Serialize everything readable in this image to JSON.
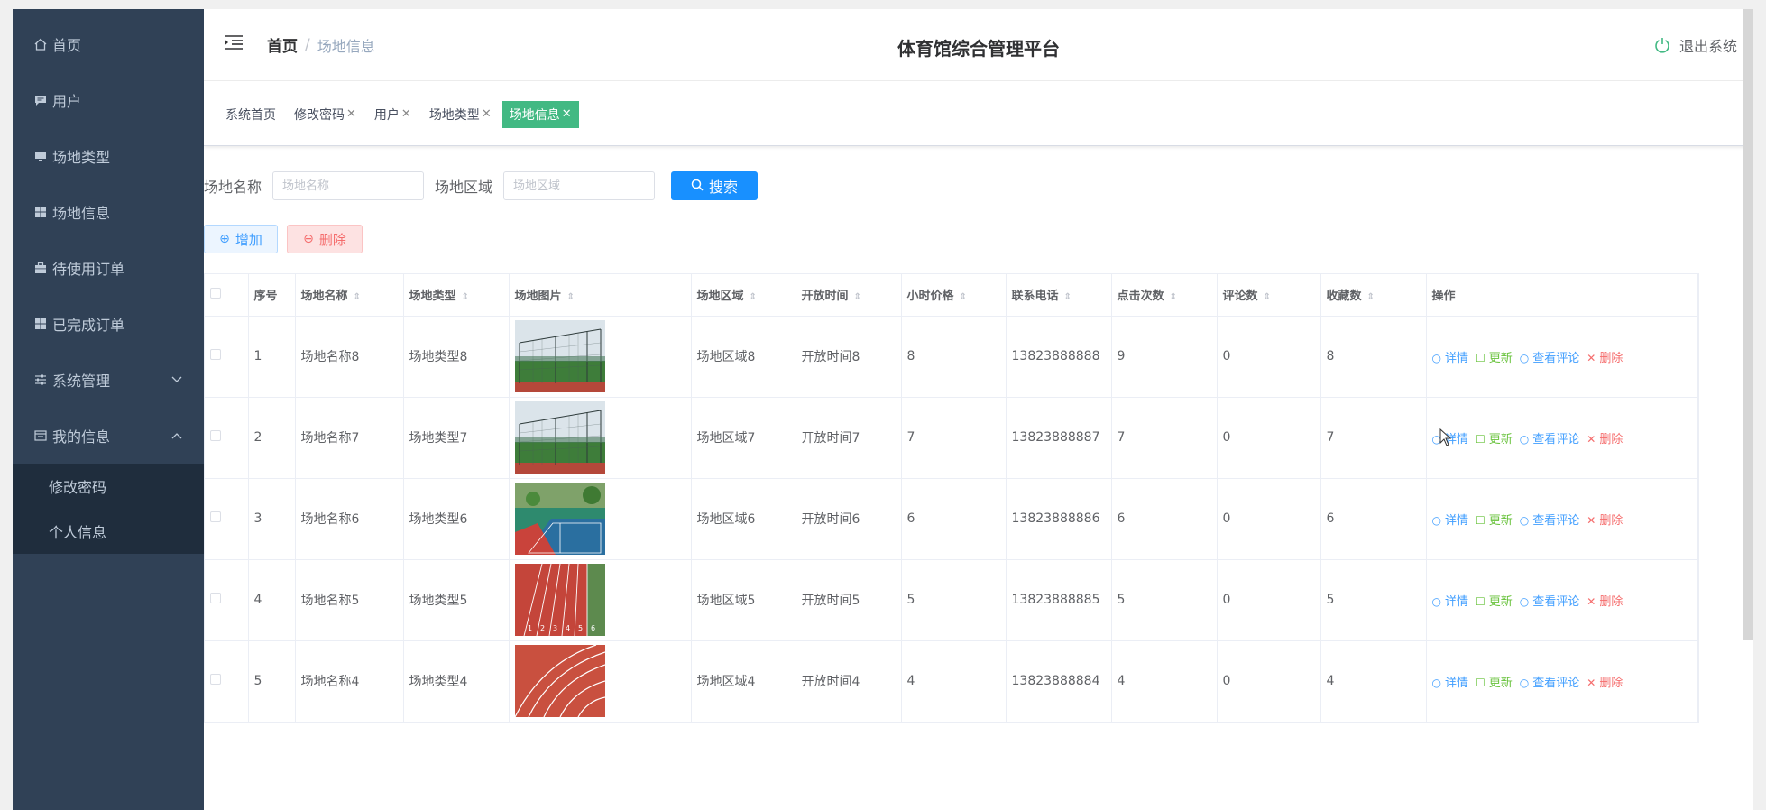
{
  "sidebar": {
    "items": [
      {
        "label": "首页",
        "icon": "home-icon"
      },
      {
        "label": "用户",
        "icon": "chat-icon"
      },
      {
        "label": "场地类型",
        "icon": "monitor-icon"
      },
      {
        "label": "场地信息",
        "icon": "grid-icon"
      },
      {
        "label": "待使用订单",
        "icon": "briefcase-icon"
      },
      {
        "label": "已完成订单",
        "icon": "grid-icon"
      },
      {
        "label": "系统管理",
        "icon": "sliders-icon"
      },
      {
        "label": "我的信息",
        "icon": "window-icon"
      }
    ],
    "sub_items": [
      "修改密码",
      "个人信息"
    ]
  },
  "header": {
    "breadcrumb_home": "首页",
    "breadcrumb_current": "场地信息",
    "title": "体育馆综合管理平台",
    "logout": "退出系统"
  },
  "tags": [
    {
      "label": "系统首页",
      "closable": false
    },
    {
      "label": "修改密码",
      "closable": true
    },
    {
      "label": "用户",
      "closable": true
    },
    {
      "label": "场地类型",
      "closable": true
    },
    {
      "label": "场地信息",
      "closable": true,
      "active": true
    }
  ],
  "search": {
    "name_label": "场地名称",
    "name_placeholder": "场地名称",
    "area_label": "场地区域",
    "area_placeholder": "场地区域",
    "button": "搜索"
  },
  "actions": {
    "add": "增加",
    "delete": "删除"
  },
  "table": {
    "columns": [
      "序号",
      "场地名称",
      "场地类型",
      "场地图片",
      "场地区域",
      "开放时间",
      "小时价格",
      "联系电话",
      "点击次数",
      "评论数",
      "收藏数",
      "操作"
    ],
    "rows": [
      {
        "idx": "1",
        "name": "场地名称8",
        "type": "场地类型8",
        "img": "tennis",
        "area": "场地区域8",
        "time": "开放时间8",
        "price": "8",
        "phone": "13823888888",
        "clicks": "9",
        "comments": "0",
        "favs": "8"
      },
      {
        "idx": "2",
        "name": "场地名称7",
        "type": "场地类型7",
        "img": "tennis",
        "area": "场地区域7",
        "time": "开放时间7",
        "price": "7",
        "phone": "13823888887",
        "clicks": "7",
        "comments": "0",
        "favs": "7"
      },
      {
        "idx": "3",
        "name": "场地名称6",
        "type": "场地类型6",
        "img": "court",
        "area": "场地区域6",
        "time": "开放时间6",
        "price": "6",
        "phone": "13823888886",
        "clicks": "6",
        "comments": "0",
        "favs": "6"
      },
      {
        "idx": "4",
        "name": "场地名称5",
        "type": "场地类型5",
        "img": "track-numbers",
        "area": "场地区域5",
        "time": "开放时间5",
        "price": "5",
        "phone": "13823888885",
        "clicks": "5",
        "comments": "0",
        "favs": "5"
      },
      {
        "idx": "5",
        "name": "场地名称4",
        "type": "场地类型4",
        "img": "track",
        "area": "场地区域4",
        "time": "开放时间4",
        "price": "4",
        "phone": "13823888884",
        "clicks": "4",
        "comments": "0",
        "favs": "4"
      }
    ],
    "ops": {
      "detail": "详情",
      "update": "更新",
      "comments": "查看评论",
      "delete": "删除"
    },
    "track_numbers": "1 2 3 4 5 6"
  },
  "colors": {
    "sidebar_bg": "#304156",
    "submenu_bg": "#1f2d3d",
    "primary": "#1890ff",
    "active_tag": "#42b983",
    "danger": "#f56c6c",
    "success": "#67c23a"
  }
}
